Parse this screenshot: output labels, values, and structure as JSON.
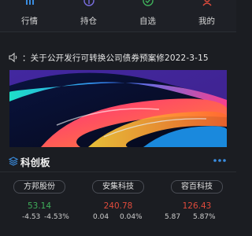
{
  "nav": {
    "items": [
      {
        "label": "行情",
        "icon": "chart-icon"
      },
      {
        "label": "持仓",
        "icon": "position-icon"
      },
      {
        "label": "自选",
        "icon": "favorite-check-icon"
      },
      {
        "label": "我的",
        "icon": "profile-icon"
      }
    ]
  },
  "notice": {
    "text": "：关于公开发行可转换公司债券预案修2022-3-15"
  },
  "banner": {
    "image": "abstract-colorful-waves-wallpaper"
  },
  "section": {
    "title": "科创板",
    "stocks": [
      {
        "name": "方邦股份",
        "price": "53.14",
        "change": "-4.53",
        "change_pct": "-4.53%",
        "trend": "down"
      },
      {
        "name": "安集科技",
        "price": "240.78",
        "change": "0.04",
        "change_pct": "0.04%",
        "trend": "up"
      },
      {
        "name": "容百科技",
        "price": "126.43",
        "change": "5.87",
        "change_pct": "5.87%",
        "trend": "up"
      }
    ]
  },
  "colors": {
    "up": "#e04b3c",
    "down": "#3fae5a",
    "background": "#1b1d22",
    "accent_blue": "#3a8de0"
  }
}
